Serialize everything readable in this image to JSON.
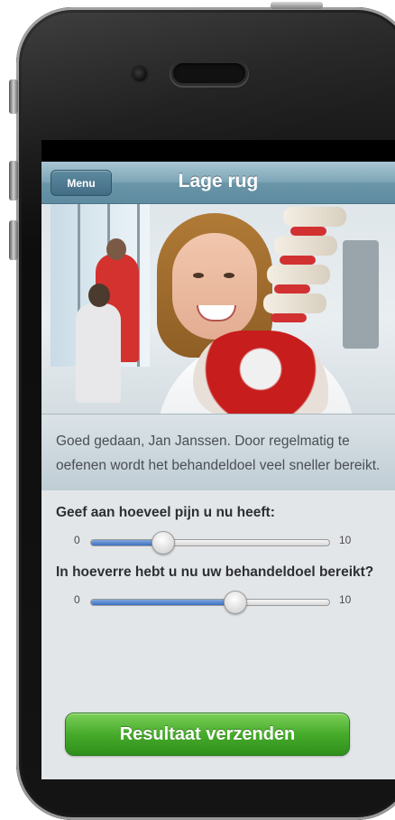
{
  "app": {
    "title": "Lage rug"
  },
  "navbar": {
    "menu_label": "Menu"
  },
  "message": {
    "text": "Goed gedaan, Jan Janssen. Door regelmatig te oefenen wordt het behandeldoel veel sneller bereikt."
  },
  "questions": [
    {
      "label": "Geef aan hoeveel pijn u nu heeft:",
      "min": "0",
      "max": "10",
      "value": 0.3
    },
    {
      "label": "In hoeverre hebt u nu uw behandeldoel bereikt?",
      "min": "0",
      "max": "10",
      "value": 0.6
    }
  ],
  "submit": {
    "label": "Resultaat verzenden"
  },
  "colors": {
    "navbar": "#6a95a8",
    "accent_slider": "#3d71c3",
    "submit_green": "#47ab2b"
  },
  "photo": {
    "description_icon": "physiotherapist-photo"
  }
}
